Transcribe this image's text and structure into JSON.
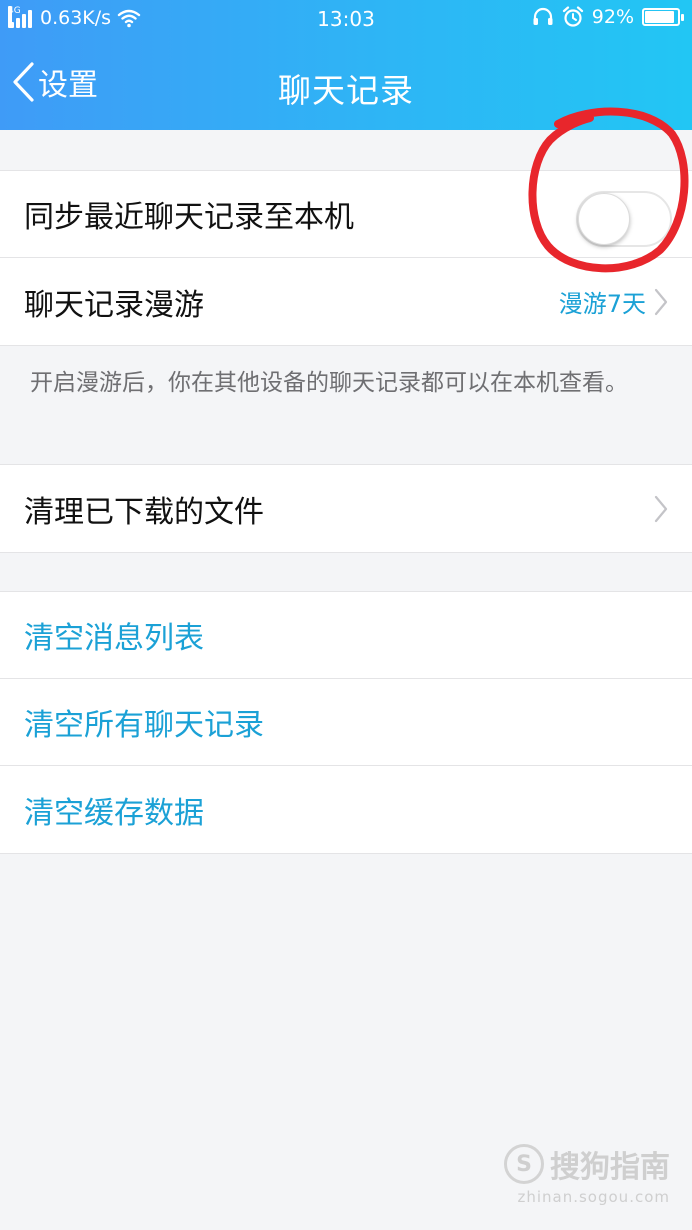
{
  "status_bar": {
    "network_type": "4G",
    "speed": "0.63K/s",
    "time": "13:03",
    "battery_percent": "92%",
    "battery_level": 0.92
  },
  "title_bar": {
    "back_label": "设置",
    "title": "聊天记录"
  },
  "sections": {
    "sync": {
      "sync_label": "同步最近聊天记录至本机",
      "sync_enabled": false,
      "roaming_label": "聊天记录漫游",
      "roaming_value": "漫游7天"
    },
    "roaming_note": "开启漫游后，你在其他设备的聊天记录都可以在本机查看。",
    "files": {
      "clean_downloads_label": "清理已下载的文件"
    },
    "clear": {
      "clear_message_list": "清空消息列表",
      "clear_all_chats": "清空所有聊天记录",
      "clear_cache": "清空缓存数据"
    }
  },
  "watermark": {
    "logo_glyph": "S",
    "brand": "搜狗指南",
    "url": "zhinan.sogou.com"
  },
  "colors": {
    "header_gradient_start": "#3f9bf7",
    "header_gradient_end": "#22c6f4",
    "link_blue": "#1ba1d6",
    "annotation_red": "#e8262c"
  }
}
